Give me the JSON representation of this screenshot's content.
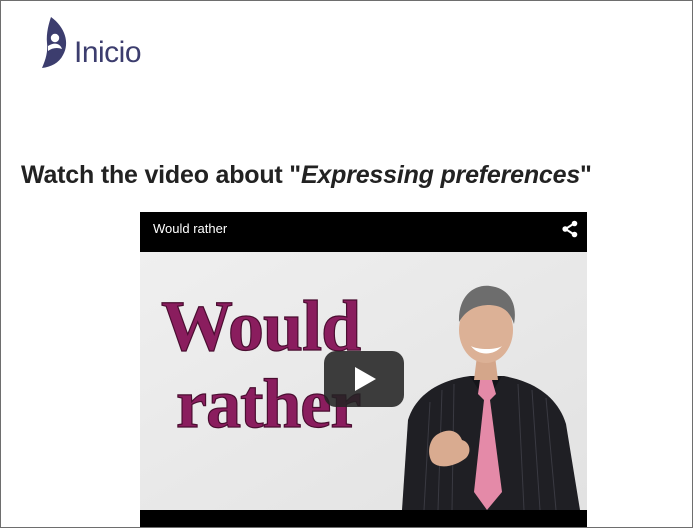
{
  "brand": {
    "name": "Inicio"
  },
  "heading": {
    "prefix": "Watch the video about \"",
    "topic": "Expressing preferences",
    "suffix": "\""
  },
  "video": {
    "title": "Would rather",
    "thumbnail_text": [
      "Would",
      "rather"
    ]
  },
  "colors": {
    "brand": "#3c3d6e",
    "thumbnail_text": "#8a1d5e",
    "tie": "#e48aa8"
  },
  "icons": [
    "logo-mark",
    "share-icon",
    "play-icon"
  ]
}
